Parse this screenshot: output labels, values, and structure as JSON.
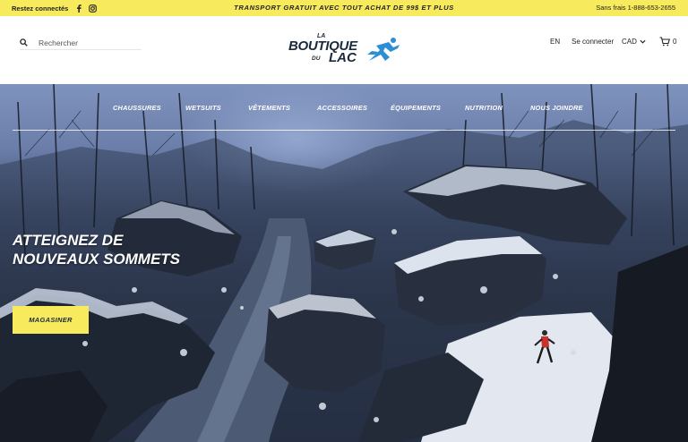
{
  "topbar": {
    "social_label": "Restez connectés",
    "social_icons": [
      "facebook-icon",
      "instagram-icon"
    ],
    "announcement": "TRANSPORT GRATUIT AVEC TOUT ACHAT DE 99$ ET PLUS",
    "phone": "Sans frais 1-888-653-2655",
    "background_color": "#f7ea5c"
  },
  "header": {
    "search_placeholder": "Rechercher",
    "logo": {
      "la": "LA",
      "boutique": "BOUTIQUE",
      "du": "DU",
      "lac": "LAC",
      "mark_color": "#2b8fd6",
      "text_color": "#1b2a3d"
    },
    "language": "EN",
    "login": "Se connecter",
    "currency": "CAD",
    "cart_count": "0"
  },
  "nav": {
    "items": [
      {
        "label": "CHAUSSURES"
      },
      {
        "label": "WETSUITS"
      },
      {
        "label": "VÊTEMENTS"
      },
      {
        "label": "ACCESSOIRES"
      },
      {
        "label": "ÉQUIPEMENTS"
      },
      {
        "label": "NUTRITION"
      },
      {
        "label": "NOUS JOINDRE"
      }
    ]
  },
  "hero": {
    "headline_line1": "ATTEIGNEZ DE",
    "headline_line2": "NOUVEAUX SOMMETS",
    "cta_label": "MAGASINER",
    "cta_color": "#f7ea5c"
  }
}
